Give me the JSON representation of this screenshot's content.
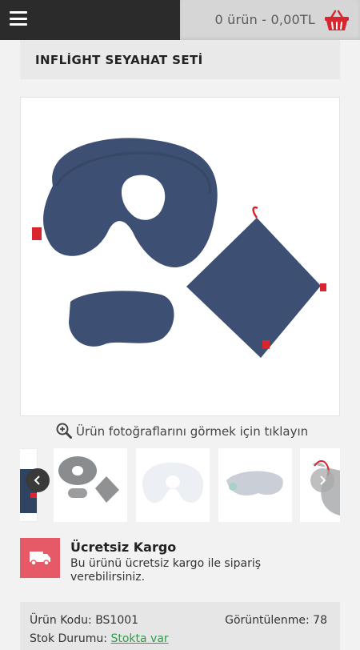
{
  "header": {
    "cart_text": "0 ürün - 0,00TL",
    "menu_icon": "hamburger-menu-icon",
    "cart_icon": "basket-icon",
    "cart_icon_color": "#d9252f"
  },
  "product": {
    "title": "INFLİGHT SEYAHAT SETİ",
    "image_alt": "Boyun yastığı, göz bandı ve taşıma çantası",
    "zoom_hint": "Ürün fotoğraflarını görmek için tıklayın",
    "thumbnails": [
      "gri-set",
      "beyaz-yastik",
      "goz-bandi",
      "kese"
    ]
  },
  "cargo": {
    "title": "Ücretsiz Kargo",
    "description": "Bu ürünü ücretsiz kargo ile sipariş verebilirsiniz.",
    "icon": "truck-icon",
    "color": "#e55a66"
  },
  "details": {
    "code_label": "Ürün Kodu:",
    "code_value": "BS1001",
    "views_label": "Görüntülenme:",
    "views_value": "78",
    "stock_label": "Stok Durumu:",
    "stock_value": "Stokta var",
    "stock_color": "#2e9e4b"
  }
}
